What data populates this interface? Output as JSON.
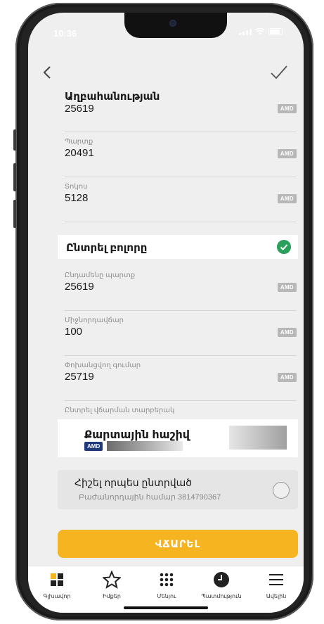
{
  "status": {
    "time": "10:36"
  },
  "rows": [
    {
      "label": "Աղբահանության",
      "value": "25619",
      "currency": "AMD",
      "label_bold": true
    },
    {
      "label": "Պարտք",
      "value": "20491",
      "currency": "AMD"
    },
    {
      "label": "Տոկոս",
      "value": "5128",
      "currency": "AMD"
    },
    {
      "label": "Ընդամենը պարտք",
      "value": "25619",
      "currency": "AMD"
    },
    {
      "label": "Միջնորդավճար",
      "value": "100",
      "currency": "AMD"
    },
    {
      "label": "Փոխանցվող գումար",
      "value": "25719",
      "currency": "AMD"
    }
  ],
  "select_all": {
    "label": "Ընտրել բոլորը",
    "checked": true
  },
  "payment_method": {
    "section_label": "Ընտրել վճարման տարբերակ",
    "title": "Քարտային հաշիվ",
    "currency": "AMD"
  },
  "remember": {
    "title": "Հիշել որպես ընտրված",
    "subtitle": "Բաժանորդային համար  3814790367"
  },
  "pay_button": {
    "label": "ՎՃԱՐԵԼ"
  },
  "tabbar": [
    {
      "label": "Գլխավոր",
      "icon": "home-grid-icon"
    },
    {
      "label": "Իմքեր",
      "icon": "star-icon"
    },
    {
      "label": "Մենյու",
      "icon": "menu-dots-icon"
    },
    {
      "label": "Պատմություն",
      "icon": "history-clock-icon"
    },
    {
      "label": "Ավելին",
      "icon": "more-lines-icon"
    }
  ],
  "colors": {
    "accent": "#f7b421",
    "success": "#2ba05c",
    "brand_blue": "#1f3a7a"
  }
}
